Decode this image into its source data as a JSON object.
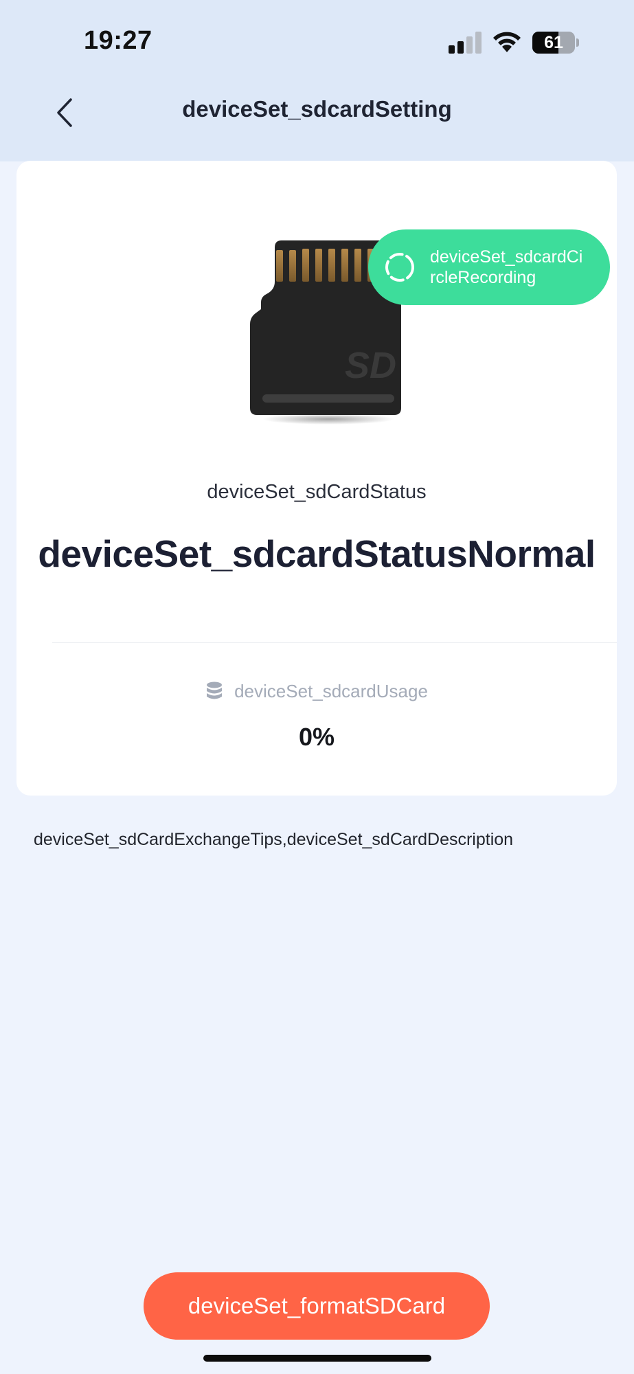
{
  "status_bar": {
    "time": "19:27",
    "battery_level": "61",
    "battery_fraction": 0.61,
    "signal_icon": "cellular-signal-icon",
    "wifi_icon": "wifi-icon"
  },
  "nav": {
    "back_icon": "chevron-left-icon",
    "title": "deviceSet_sdcardSetting"
  },
  "card": {
    "image": "sd-card-icon",
    "image_text": "SD",
    "recording_badge": "deviceSet_sdcardCircleRecording",
    "recording_icon": "dashed-circle-icon",
    "status_caption": "deviceSet_sdCardStatus",
    "status_value": "deviceSet_sdcardStatusNormal",
    "usage_icon": "database-icon",
    "usage_label": "deviceSet_sdcardUsage",
    "usage_value": "0%"
  },
  "tips": "deviceSet_sdCardExchangeTips,deviceSet_sdCardDescription",
  "format_button": "deviceSet_formatSDCard",
  "colors": {
    "header_bg": "#dde8f8",
    "page_bg": "#eef3fd",
    "recording_badge": "#3ddd9b",
    "format_button": "#ff6446"
  }
}
